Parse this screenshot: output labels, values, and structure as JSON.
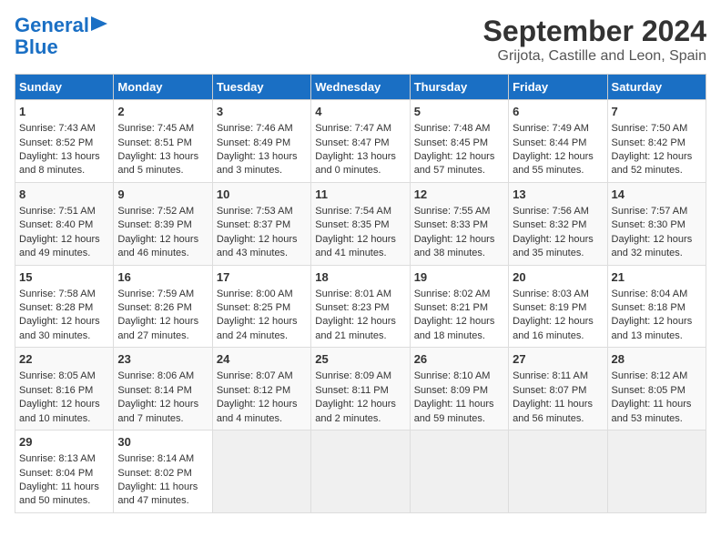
{
  "header": {
    "logo_line1": "General",
    "logo_line2": "Blue",
    "title": "September 2024",
    "subtitle": "Grijota, Castille and Leon, Spain"
  },
  "days_of_week": [
    "Sunday",
    "Monday",
    "Tuesday",
    "Wednesday",
    "Thursday",
    "Friday",
    "Saturday"
  ],
  "weeks": [
    [
      {
        "day": "1",
        "lines": [
          "Sunrise: 7:43 AM",
          "Sunset: 8:52 PM",
          "Daylight: 13 hours",
          "and 8 minutes."
        ]
      },
      {
        "day": "2",
        "lines": [
          "Sunrise: 7:45 AM",
          "Sunset: 8:51 PM",
          "Daylight: 13 hours",
          "and 5 minutes."
        ]
      },
      {
        "day": "3",
        "lines": [
          "Sunrise: 7:46 AM",
          "Sunset: 8:49 PM",
          "Daylight: 13 hours",
          "and 3 minutes."
        ]
      },
      {
        "day": "4",
        "lines": [
          "Sunrise: 7:47 AM",
          "Sunset: 8:47 PM",
          "Daylight: 13 hours",
          "and 0 minutes."
        ]
      },
      {
        "day": "5",
        "lines": [
          "Sunrise: 7:48 AM",
          "Sunset: 8:45 PM",
          "Daylight: 12 hours",
          "and 57 minutes."
        ]
      },
      {
        "day": "6",
        "lines": [
          "Sunrise: 7:49 AM",
          "Sunset: 8:44 PM",
          "Daylight: 12 hours",
          "and 55 minutes."
        ]
      },
      {
        "day": "7",
        "lines": [
          "Sunrise: 7:50 AM",
          "Sunset: 8:42 PM",
          "Daylight: 12 hours",
          "and 52 minutes."
        ]
      }
    ],
    [
      {
        "day": "8",
        "lines": [
          "Sunrise: 7:51 AM",
          "Sunset: 8:40 PM",
          "Daylight: 12 hours",
          "and 49 minutes."
        ]
      },
      {
        "day": "9",
        "lines": [
          "Sunrise: 7:52 AM",
          "Sunset: 8:39 PM",
          "Daylight: 12 hours",
          "and 46 minutes."
        ]
      },
      {
        "day": "10",
        "lines": [
          "Sunrise: 7:53 AM",
          "Sunset: 8:37 PM",
          "Daylight: 12 hours",
          "and 43 minutes."
        ]
      },
      {
        "day": "11",
        "lines": [
          "Sunrise: 7:54 AM",
          "Sunset: 8:35 PM",
          "Daylight: 12 hours",
          "and 41 minutes."
        ]
      },
      {
        "day": "12",
        "lines": [
          "Sunrise: 7:55 AM",
          "Sunset: 8:33 PM",
          "Daylight: 12 hours",
          "and 38 minutes."
        ]
      },
      {
        "day": "13",
        "lines": [
          "Sunrise: 7:56 AM",
          "Sunset: 8:32 PM",
          "Daylight: 12 hours",
          "and 35 minutes."
        ]
      },
      {
        "day": "14",
        "lines": [
          "Sunrise: 7:57 AM",
          "Sunset: 8:30 PM",
          "Daylight: 12 hours",
          "and 32 minutes."
        ]
      }
    ],
    [
      {
        "day": "15",
        "lines": [
          "Sunrise: 7:58 AM",
          "Sunset: 8:28 PM",
          "Daylight: 12 hours",
          "and 30 minutes."
        ]
      },
      {
        "day": "16",
        "lines": [
          "Sunrise: 7:59 AM",
          "Sunset: 8:26 PM",
          "Daylight: 12 hours",
          "and 27 minutes."
        ]
      },
      {
        "day": "17",
        "lines": [
          "Sunrise: 8:00 AM",
          "Sunset: 8:25 PM",
          "Daylight: 12 hours",
          "and 24 minutes."
        ]
      },
      {
        "day": "18",
        "lines": [
          "Sunrise: 8:01 AM",
          "Sunset: 8:23 PM",
          "Daylight: 12 hours",
          "and 21 minutes."
        ]
      },
      {
        "day": "19",
        "lines": [
          "Sunrise: 8:02 AM",
          "Sunset: 8:21 PM",
          "Daylight: 12 hours",
          "and 18 minutes."
        ]
      },
      {
        "day": "20",
        "lines": [
          "Sunrise: 8:03 AM",
          "Sunset: 8:19 PM",
          "Daylight: 12 hours",
          "and 16 minutes."
        ]
      },
      {
        "day": "21",
        "lines": [
          "Sunrise: 8:04 AM",
          "Sunset: 8:18 PM",
          "Daylight: 12 hours",
          "and 13 minutes."
        ]
      }
    ],
    [
      {
        "day": "22",
        "lines": [
          "Sunrise: 8:05 AM",
          "Sunset: 8:16 PM",
          "Daylight: 12 hours",
          "and 10 minutes."
        ]
      },
      {
        "day": "23",
        "lines": [
          "Sunrise: 8:06 AM",
          "Sunset: 8:14 PM",
          "Daylight: 12 hours",
          "and 7 minutes."
        ]
      },
      {
        "day": "24",
        "lines": [
          "Sunrise: 8:07 AM",
          "Sunset: 8:12 PM",
          "Daylight: 12 hours",
          "and 4 minutes."
        ]
      },
      {
        "day": "25",
        "lines": [
          "Sunrise: 8:09 AM",
          "Sunset: 8:11 PM",
          "Daylight: 12 hours",
          "and 2 minutes."
        ]
      },
      {
        "day": "26",
        "lines": [
          "Sunrise: 8:10 AM",
          "Sunset: 8:09 PM",
          "Daylight: 11 hours",
          "and 59 minutes."
        ]
      },
      {
        "day": "27",
        "lines": [
          "Sunrise: 8:11 AM",
          "Sunset: 8:07 PM",
          "Daylight: 11 hours",
          "and 56 minutes."
        ]
      },
      {
        "day": "28",
        "lines": [
          "Sunrise: 8:12 AM",
          "Sunset: 8:05 PM",
          "Daylight: 11 hours",
          "and 53 minutes."
        ]
      }
    ],
    [
      {
        "day": "29",
        "lines": [
          "Sunrise: 8:13 AM",
          "Sunset: 8:04 PM",
          "Daylight: 11 hours",
          "and 50 minutes."
        ]
      },
      {
        "day": "30",
        "lines": [
          "Sunrise: 8:14 AM",
          "Sunset: 8:02 PM",
          "Daylight: 11 hours",
          "and 47 minutes."
        ]
      },
      {
        "day": "",
        "lines": []
      },
      {
        "day": "",
        "lines": []
      },
      {
        "day": "",
        "lines": []
      },
      {
        "day": "",
        "lines": []
      },
      {
        "day": "",
        "lines": []
      }
    ]
  ]
}
